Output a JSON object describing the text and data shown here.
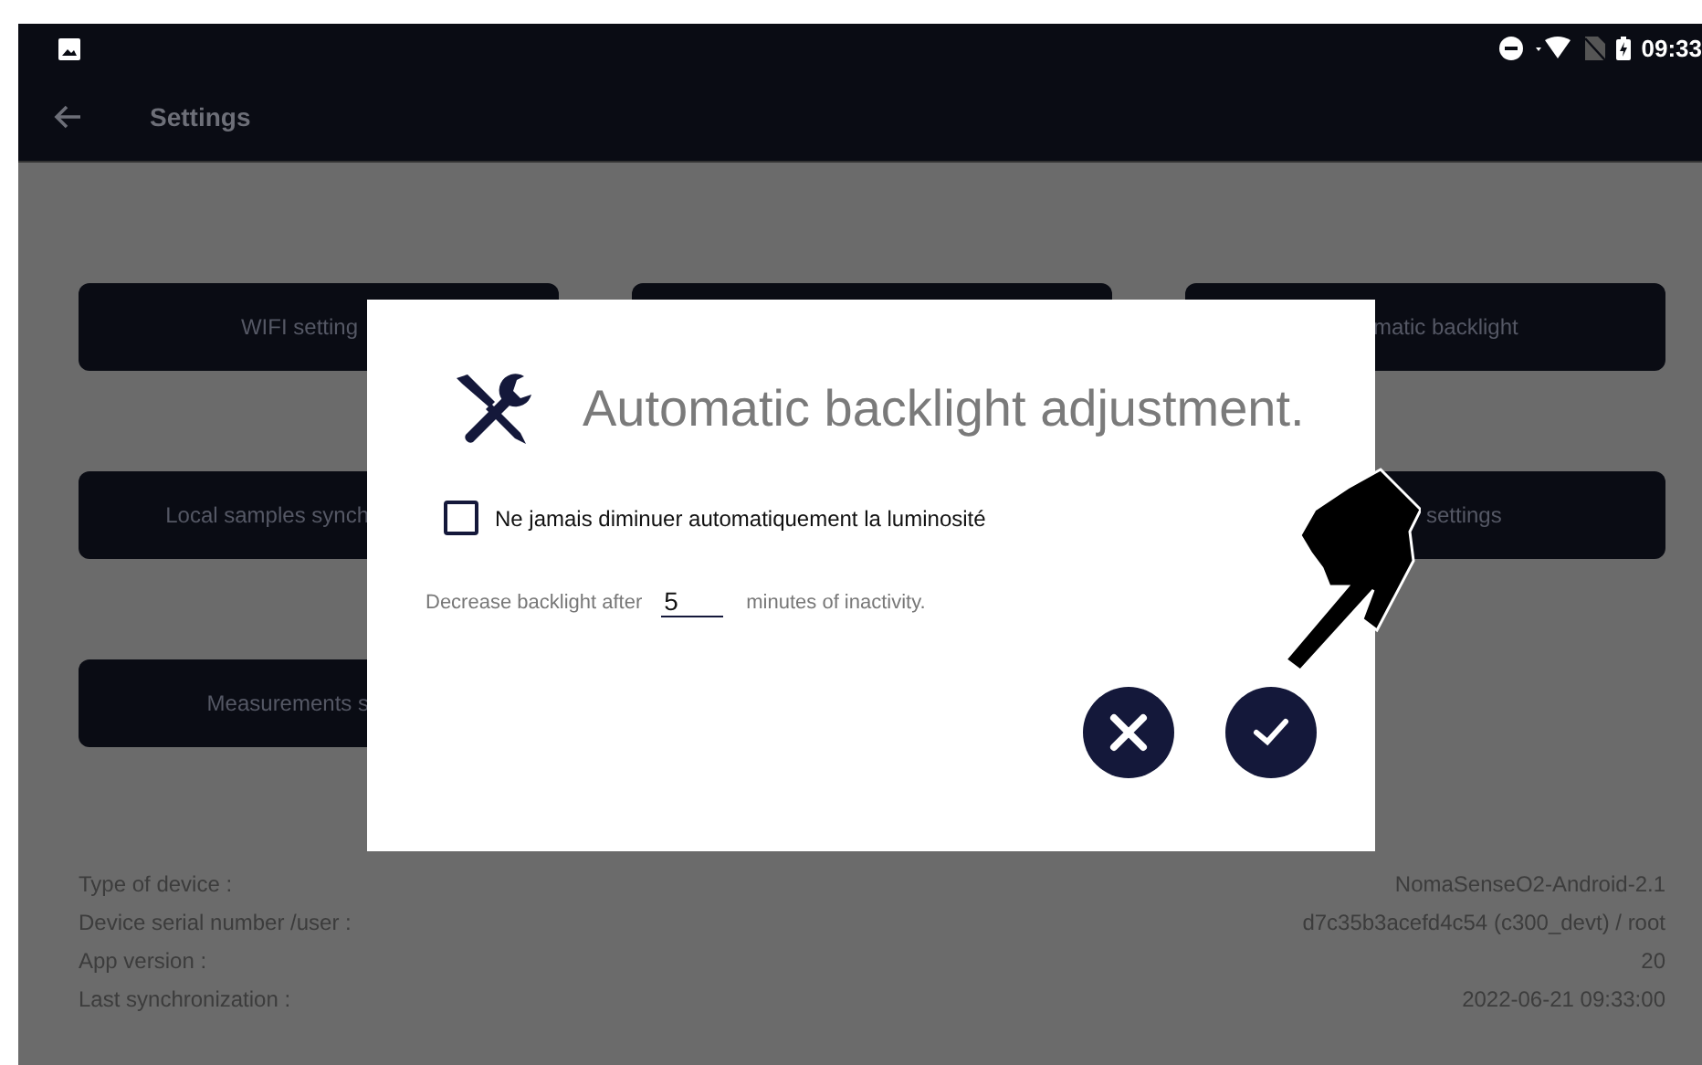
{
  "status_bar": {
    "time": "09:33"
  },
  "app_bar": {
    "title": "Settings"
  },
  "settings_rows": [
    {
      "left": "WIFI setting",
      "right": "matic backlight"
    },
    {
      "left": "Local samples synch",
      "right": "settings"
    },
    {
      "left": "Measurements s"
    }
  ],
  "device_info": [
    {
      "label": "Type of device :",
      "value": "NomaSenseO2-Android-2.1"
    },
    {
      "label": "Device serial number /user :",
      "value": "d7c35b3acefd4c54 (c300_devt) / root"
    },
    {
      "label": "App version :",
      "value": "20"
    },
    {
      "label": "Last synchronization :",
      "value": "2022-06-21 09:33:00"
    }
  ],
  "dialog": {
    "title": "Automatic backlight adjustment.",
    "checkbox": {
      "label": "Ne jamais diminuer automatiquement la luminosité",
      "checked": false
    },
    "delay": {
      "before": "Decrease backlight after",
      "value": "5",
      "after": "minutes of inactivity."
    }
  }
}
